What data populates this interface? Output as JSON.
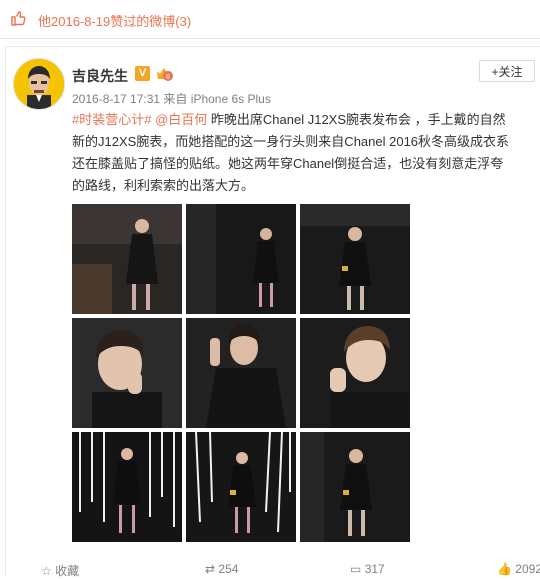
{
  "header": {
    "title": "他2016-8-19赞过的微博(3)"
  },
  "post": {
    "username": "吉良先生",
    "verified_badge": "V",
    "follow_label": "+关注",
    "timestamp": "2016-8-17 17:31",
    "via_prefix": "来自",
    "device": "iPhone 6s Plus",
    "text_lines": [
      {
        "tag": "#时装营心计#",
        "mention": "@白百何",
        "rest": " 昨晚出席Chanel J12XS腕表发布会 ，手上戴的自然"
      },
      {
        "rest": "新的J12XS腕表，而她搭配的这一身行头则来自Chanel 2016秋冬高级成衣系"
      },
      {
        "rest": "还在膝盖贴了搞怪的贴纸。她这两年穿Chanel倒挺合适，也没有刻意走浮夸"
      },
      {
        "rest": "的路线，利利索索的出落大方。"
      }
    ]
  },
  "actions": {
    "favorite": "收藏",
    "repost_count": "254",
    "comment_count": "317",
    "like_count": "2092"
  },
  "colors": {
    "accent": "#eb7350",
    "meta_gray": "#808080",
    "photo_dark": "#1b1b1b"
  }
}
